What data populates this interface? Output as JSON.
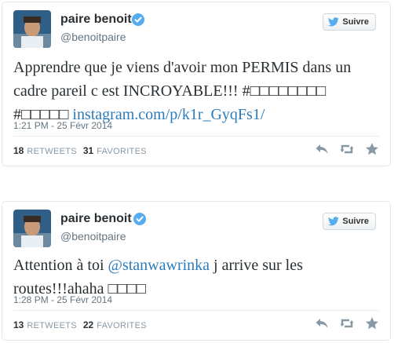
{
  "follow_label": "Suivre",
  "tweets": [
    {
      "name": "paire benoit",
      "handle": "@benoitpaire",
      "text_before": "Apprendre que je viens d'avoir mon PERMIS dans un cadre pareil c est INCROYABLE!!! #□□□□□□□□ #□□□□□ ",
      "link": "instagram.com/p/k1r_GyqFs1/",
      "text_after": "",
      "timestamp": "1:21 PM - 25 Févr 2014",
      "retweets": "18",
      "retweets_label": "RETWEETS",
      "favorites": "31",
      "favorites_label": "FAVORITES"
    },
    {
      "name": "paire benoit",
      "handle": "@benoitpaire",
      "text_before": "Attention à toi ",
      "link": "@stanwawrinka",
      "text_after": " j arrive sur les routes!!!ahaha □□□□",
      "timestamp": "1:28 PM - 25 Févr 2014",
      "retweets": "13",
      "retweets_label": "RETWEETS",
      "favorites": "22",
      "favorites_label": "FAVORITES"
    }
  ],
  "icons": {
    "verified": "verified-badge-icon",
    "twitter_bird": "twitter-bird-icon",
    "reply": "reply-icon",
    "retweet": "retweet-icon",
    "favorite": "star-icon"
  },
  "colors": {
    "link": "#2b7bb9",
    "verified": "#55acee",
    "muted": "#8899a6",
    "text": "#292f33"
  }
}
